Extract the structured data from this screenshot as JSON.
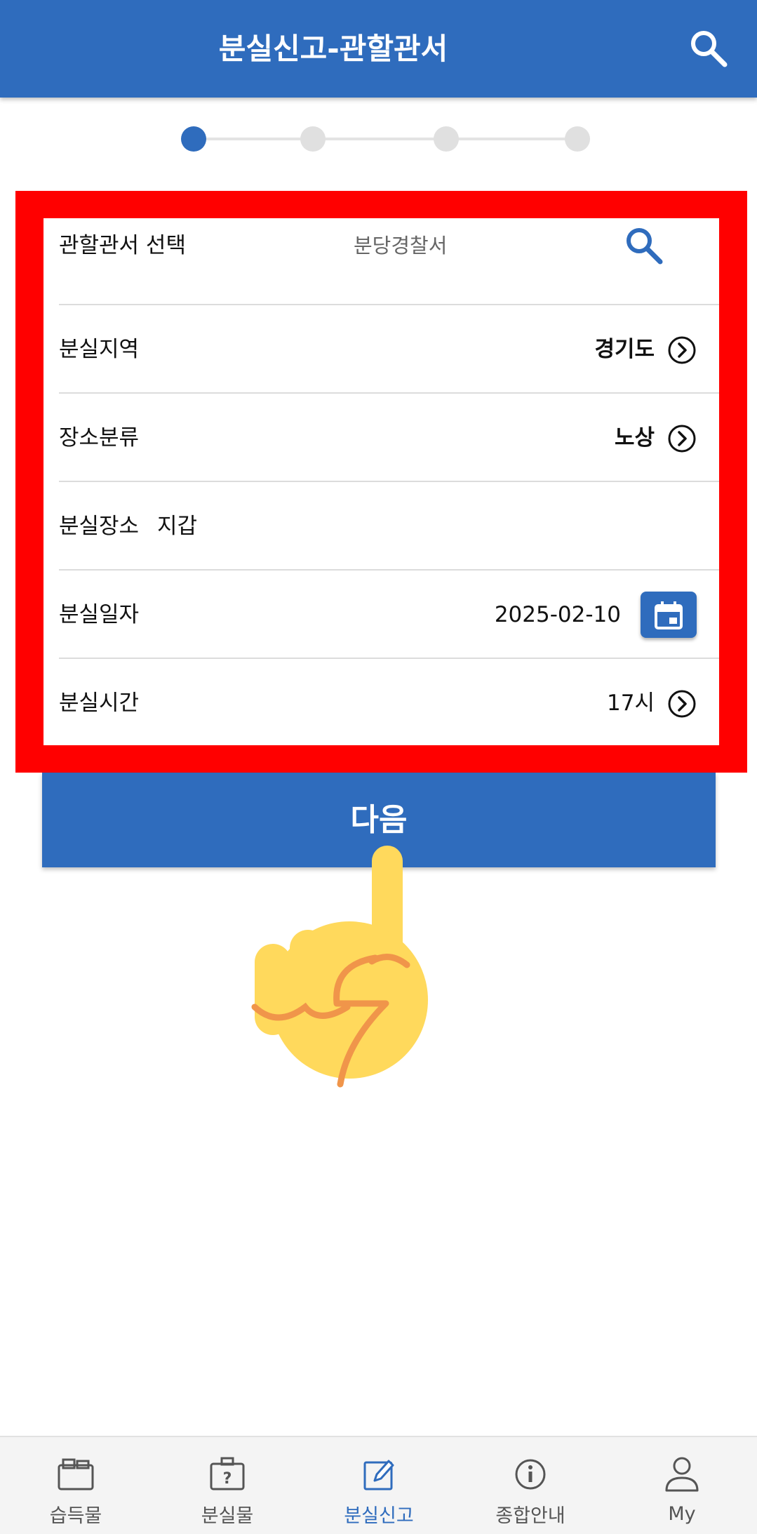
{
  "header": {
    "title": "분실신고-관할관서"
  },
  "stepper": {
    "total": 4,
    "current": 1
  },
  "form": {
    "station": {
      "label": "관할관서 선택",
      "value": "분당경찰서"
    },
    "region": {
      "label": "분실지역",
      "value": "경기도"
    },
    "place_type": {
      "label": "장소분류",
      "value": "노상"
    },
    "place": {
      "label": "분실장소",
      "value": "지갑"
    },
    "date": {
      "label": "분실일자",
      "value": "2025-02-10"
    },
    "time": {
      "label": "분실시간",
      "value": "17시"
    }
  },
  "next_button": {
    "label": "다음"
  },
  "bottom_nav": {
    "items": [
      {
        "label": "습득물",
        "icon": "found-items-icon"
      },
      {
        "label": "분실물",
        "icon": "lost-items-icon"
      },
      {
        "label": "분실신고",
        "icon": "report-edit-icon",
        "active": true
      },
      {
        "label": "종합안내",
        "icon": "info-icon"
      },
      {
        "label": "My",
        "icon": "user-icon"
      }
    ]
  },
  "colors": {
    "primary": "#2f6cbd",
    "highlight": "#ff0000"
  }
}
